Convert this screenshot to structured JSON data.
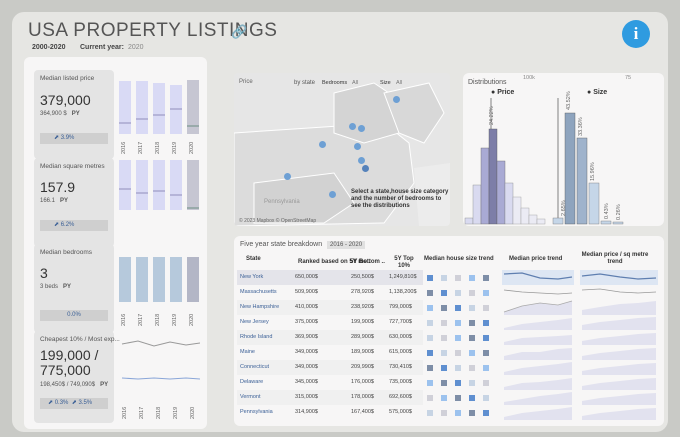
{
  "header": {
    "title": "USA PROPERTY LISTINGS",
    "period": "2000-2020",
    "current_year_label": "Current year:",
    "current_year": "2020"
  },
  "kpis": [
    {
      "label": "Median listed price",
      "value": "379,000",
      "py_value": "364,900 $",
      "py": "PY",
      "change": "3.9%"
    },
    {
      "label": "Median square metres",
      "value": "157.9",
      "py_value": "166.1",
      "py": "PY",
      "change": "6.2%"
    },
    {
      "label": "Median bedrooms",
      "value": "3",
      "py_value": "3 beds",
      "py": "PY",
      "change": "0.0%"
    },
    {
      "label": "Cheapest 10% / Most exp...",
      "value": "199,000 /",
      "value2": "775,000",
      "py_value": "198,450$ / 749,090$",
      "py": "PY",
      "change": "0.3%",
      "change2": "3.5%"
    }
  ],
  "years": [
    "2016",
    "2017",
    "2018",
    "2019",
    "2020"
  ],
  "map": {
    "price_label": "Price",
    "by_state_label": "by state",
    "bedrooms_label": "Bedrooms",
    "bedrooms_value": "All",
    "size_label": "Size",
    "size_value": "All",
    "hint": "Select a state,house size category and the number of bedrooms to see the distributions",
    "copyright": "© 2023 Mapbox © OpenStreetMap",
    "place_label": "Pennsylvania"
  },
  "distributions": {
    "title": "Distributions",
    "price_title": "Price",
    "size_title": "Size",
    "price_top": "100k",
    "size_top": "75",
    "price_pct": "24.22%",
    "size_pcts": [
      "2.65%",
      "43.52%",
      "33.36%",
      "15.96%",
      "0.43%",
      "0.26%"
    ]
  },
  "table": {
    "title": "Five year state breakdown",
    "range": "2016 - 2020",
    "headers": [
      "State",
      "Ranked based on 5Y me..",
      "5Y Bottom ..",
      "5Y Top 10%",
      "Median house size trend",
      "Median price trend",
      "Median price / sq metre trend"
    ],
    "rows": [
      [
        "New York",
        "650,000$",
        "250,500$",
        "1,249,810$"
      ],
      [
        "Massachusetts",
        "509,900$",
        "278,920$",
        "1,138,200$"
      ],
      [
        "New Hampshire",
        "410,000$",
        "238,920$",
        "799,000$"
      ],
      [
        "New Jersey",
        "375,000$",
        "199,900$",
        "727,700$"
      ],
      [
        "Rhode Island",
        "369,900$",
        "289,900$",
        "630,000$"
      ],
      [
        "Maine",
        "349,000$",
        "189,900$",
        "615,000$"
      ],
      [
        "Connecticut",
        "349,000$",
        "209,990$",
        "730,410$"
      ],
      [
        "Delaware",
        "345,000$",
        "176,000$",
        "735,000$"
      ],
      [
        "Vermont",
        "315,000$",
        "178,000$",
        "692,600$"
      ],
      [
        "Pennsylvania",
        "314,900$",
        "167,400$",
        "575,000$"
      ]
    ]
  }
}
